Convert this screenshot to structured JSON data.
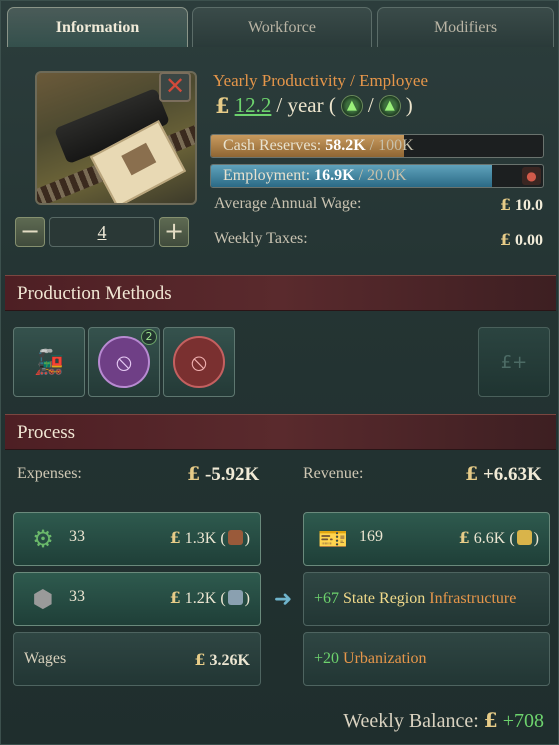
{
  "tabs": [
    {
      "label": "Information",
      "active": true
    },
    {
      "label": "Workforce",
      "active": false
    },
    {
      "label": "Modifiers",
      "active": false
    }
  ],
  "building": {
    "level": "4",
    "minus_label": "−",
    "plus_label": "+",
    "close_label": "✕",
    "icon": "railway-ticket-icon"
  },
  "productivity": {
    "title": "Yearly Productivity / Employee",
    "currency": "£",
    "value": "12.2",
    "unit": "/ year (",
    "separator": "/",
    "close_paren": ")"
  },
  "cash_reserves": {
    "label": "Cash Reserves:",
    "value": "58.2K",
    "max": "/ 100K",
    "fraction": 0.582
  },
  "employment": {
    "label": "Employment:",
    "value": "16.9K",
    "max": "/ 20.0K",
    "fraction": 0.845
  },
  "stats": {
    "wage_label": "Average Annual Wage:",
    "wage_value": "10.0",
    "taxes_label": "Weekly Taxes:",
    "taxes_value": "0.00",
    "currency": "£"
  },
  "sections": {
    "production_methods": "Production Methods",
    "process": "Process"
  },
  "methods": [
    {
      "icon": "locomotive-icon",
      "active": true
    },
    {
      "icon": "passenger-train-disabled-icon",
      "badge": "2"
    },
    {
      "icon": "freight-train-disabled-icon"
    }
  ],
  "process": {
    "expenses_label": "Expenses:",
    "expenses_value": "-5.92K",
    "revenue_label": "Revenue:",
    "revenue_value": "+6.63K",
    "currency": "£",
    "inputs": [
      {
        "icon": "engines-icon",
        "count": "33",
        "amount": "1.3K",
        "res_icon": "barrel-icon"
      },
      {
        "icon": "coal-icon",
        "count": "33",
        "amount": "1.2K",
        "res_icon": "coins-stack-icon"
      }
    ],
    "wages_label": "Wages",
    "wages_value": "3.26K",
    "output": {
      "icon": "transportation-ticket-icon",
      "count": "169",
      "amount": "6.6K",
      "res_icon": "gold-coins-icon"
    },
    "effects": [
      {
        "value": "+67",
        "text1": "State Region",
        "text2": "Infrastructure"
      },
      {
        "value": "+20",
        "text1": "Urbanization"
      }
    ],
    "paren_open": "(",
    "paren_close": ")"
  },
  "balance": {
    "label": "Weekly Balance:",
    "currency": "£",
    "value": "+708"
  }
}
